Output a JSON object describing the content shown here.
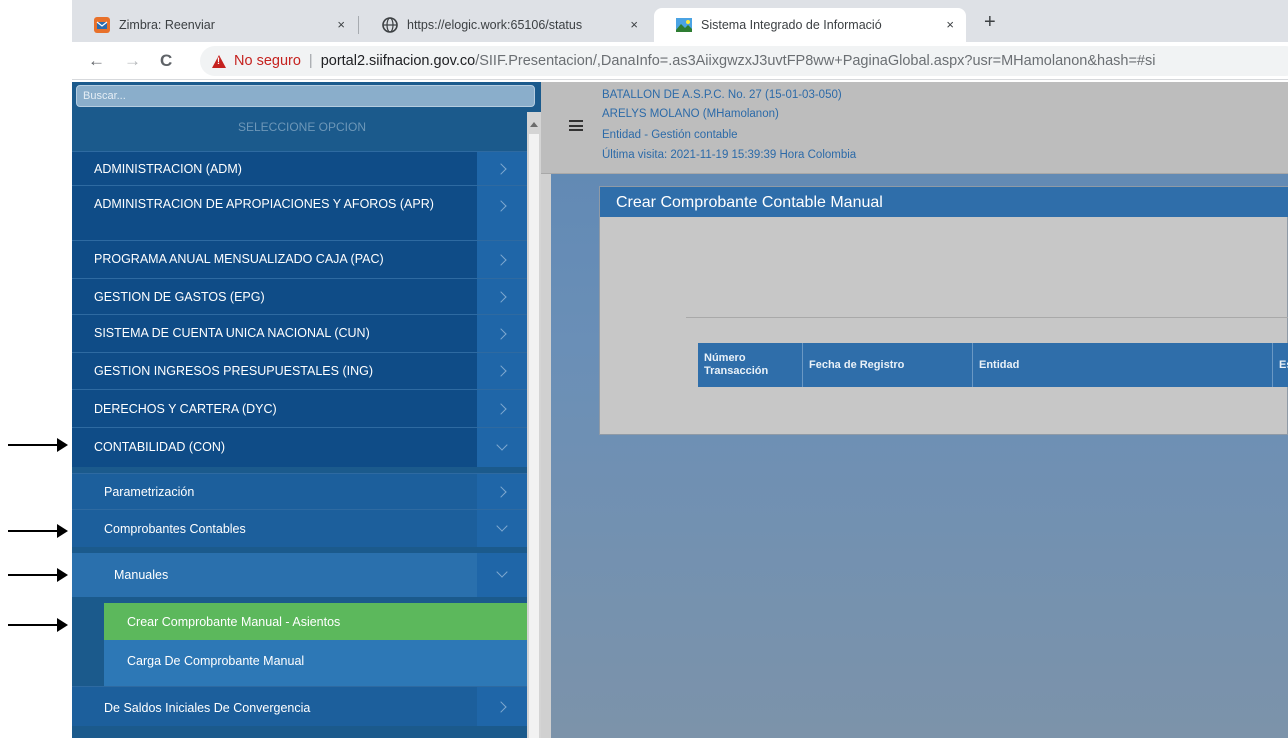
{
  "browser": {
    "tabs": [
      {
        "title": "Zimbra: Reenviar",
        "close": "×"
      },
      {
        "title": "https://elogic.work:65106/status",
        "close": "×"
      },
      {
        "title": "Sistema Integrado de Informació",
        "close": "×"
      }
    ],
    "new_tab": "+",
    "nav": {
      "back": "←",
      "forward": "→",
      "reload": "C"
    },
    "security_label": "No seguro",
    "url_host": "portal2.siifnacion.gov.co",
    "url_path": "/SIIF.Presentacion/,DanaInfo=.as3AiixgwzxJ3uvtFP8ww+PaginaGlobal.aspx?usr=MHamolanon&hash=#si"
  },
  "sidebar": {
    "search_placeholder": "Buscar...",
    "title": "SELECCIONE OPCION",
    "items": [
      {
        "label": "ADMINISTRACION (ADM)"
      },
      {
        "label": "ADMINISTRACION DE APROPIACIONES Y AFOROS (APR)"
      },
      {
        "label": "PROGRAMA ANUAL MENSUALIZADO CAJA (PAC)"
      },
      {
        "label": "GESTION DE GASTOS (EPG)"
      },
      {
        "label": "SISTEMA DE CUENTA UNICA NACIONAL (CUN)"
      },
      {
        "label": "GESTION INGRESOS PRESUPUESTALES (ING)"
      },
      {
        "label": "DERECHOS Y CARTERA (DYC)"
      },
      {
        "label": "CONTABILIDAD (CON)"
      }
    ],
    "con_children": [
      {
        "label": "Parametrización"
      },
      {
        "label": "Comprobantes Contables"
      }
    ],
    "manuales": {
      "label": "Manuales"
    },
    "manuales_children": [
      {
        "label": "Crear Comprobante Manual - Asientos"
      },
      {
        "label": "Carga De Comprobante Manual"
      }
    ],
    "after": {
      "label": "De Saldos Iniciales De Convergencia"
    }
  },
  "header": {
    "entity": "BATALLON DE A.S.P.C. No. 27 (15-01-03-050)",
    "user": "ARELYS MOLANO (MHamolanon)",
    "profile": "Entidad - Gestión contable",
    "last_visit": "Última visita: 2021-11-19 15:39:39 Hora Colombia"
  },
  "panel": {
    "title": "Crear Comprobante Contable Manual",
    "columns": [
      "Número Transacción",
      "Fecha de Registro",
      "Entidad",
      "Es"
    ]
  },
  "colors": {
    "sidebar_bg": "#0f4c87",
    "active_item": "#5cb85c",
    "panel_header": "#2f6eaa"
  }
}
